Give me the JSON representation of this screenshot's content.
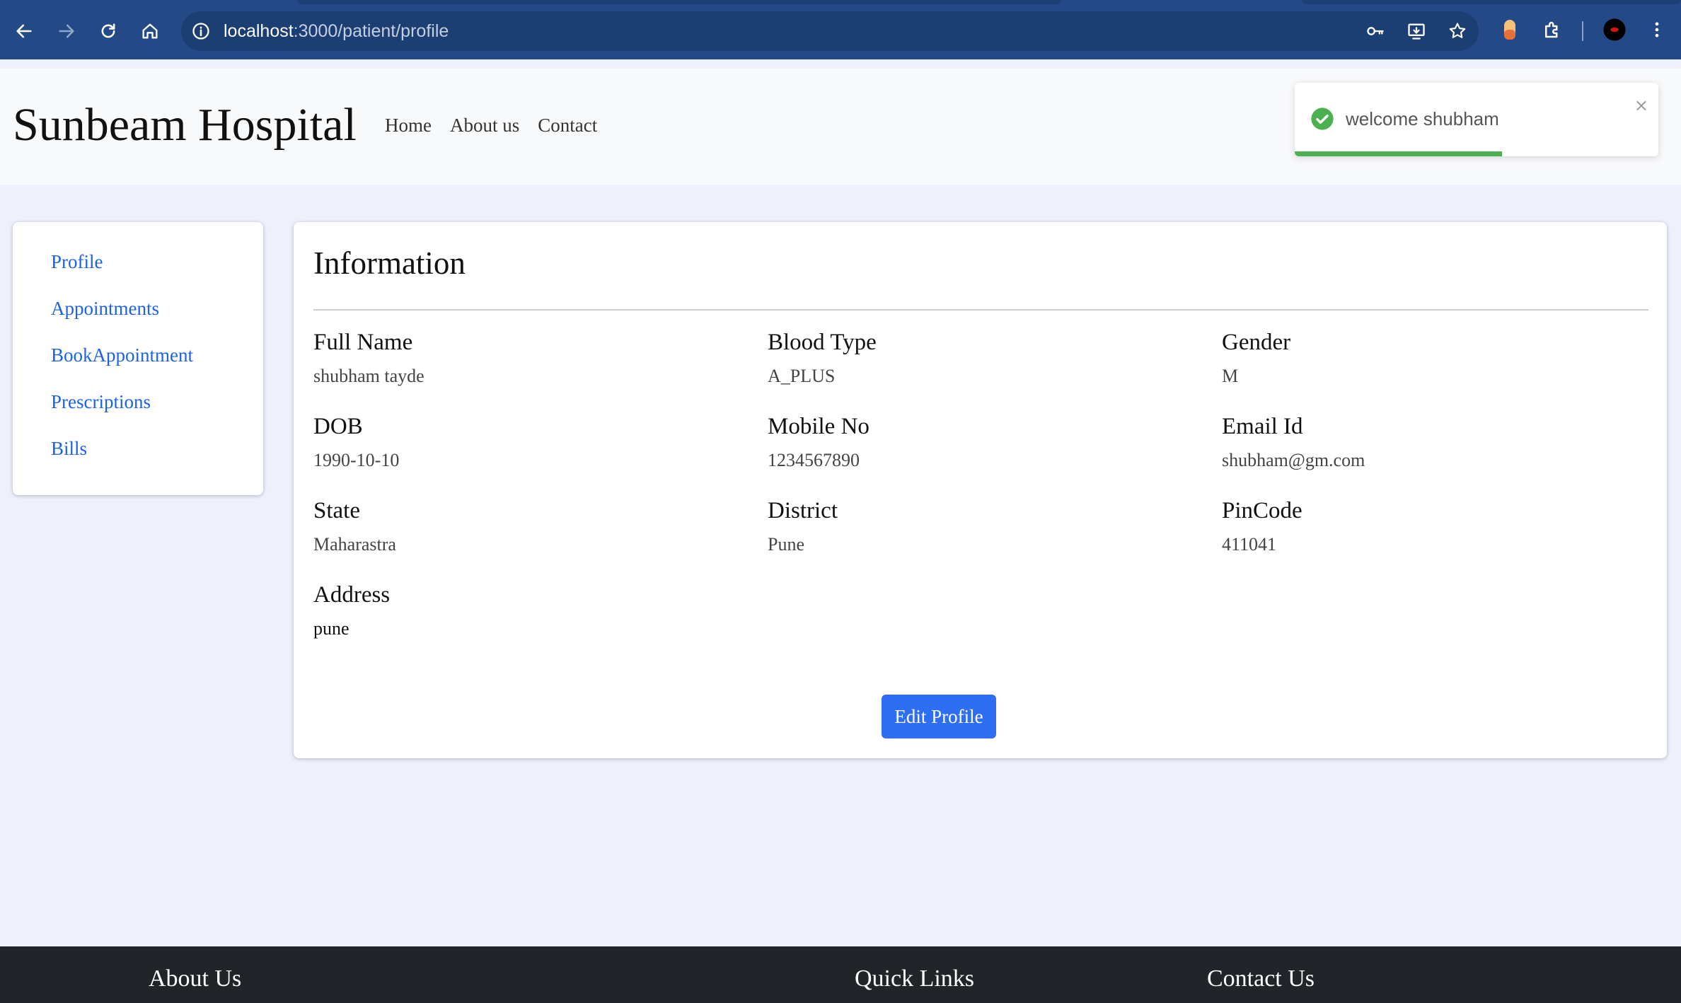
{
  "browser": {
    "url_host": "localhost",
    "url_path": ":3000/patient/profile"
  },
  "header": {
    "brand": "Sunbeam Hospital",
    "nav": [
      "Home",
      "About us",
      "Contact"
    ]
  },
  "toast": {
    "message": "welcome shubham",
    "close_label": "×",
    "progress_percent": 57
  },
  "sidebar": {
    "items": [
      {
        "label": "Profile"
      },
      {
        "label": "Appointments"
      },
      {
        "label": "BookAppointment"
      },
      {
        "label": "Prescriptions"
      },
      {
        "label": "Bills"
      }
    ]
  },
  "profile": {
    "title": "Information",
    "fields": {
      "full_name": {
        "label": "Full Name",
        "value": "shubham tayde"
      },
      "blood_type": {
        "label": "Blood Type",
        "value": "A_PLUS"
      },
      "gender": {
        "label": "Gender",
        "value": "M"
      },
      "dob": {
        "label": "DOB",
        "value": "1990-10-10"
      },
      "mobile": {
        "label": "Mobile No",
        "value": "1234567890"
      },
      "email": {
        "label": "Email Id",
        "value": "shubham@gm.com"
      },
      "state": {
        "label": "State",
        "value": "Maharastra"
      },
      "district": {
        "label": "District",
        "value": "Pune"
      },
      "pincode": {
        "label": "PinCode",
        "value": "411041"
      },
      "address": {
        "label": "Address",
        "value": "pune"
      }
    },
    "edit_label": "Edit Profile"
  },
  "footer": {
    "about": "About Us",
    "quick_links": "Quick Links",
    "contact": "Contact Us"
  },
  "colors": {
    "accent": "#2e6ef2",
    "link": "#1a62e8",
    "success": "#4caf50",
    "chrome": "#234a86",
    "footer": "#212529"
  }
}
